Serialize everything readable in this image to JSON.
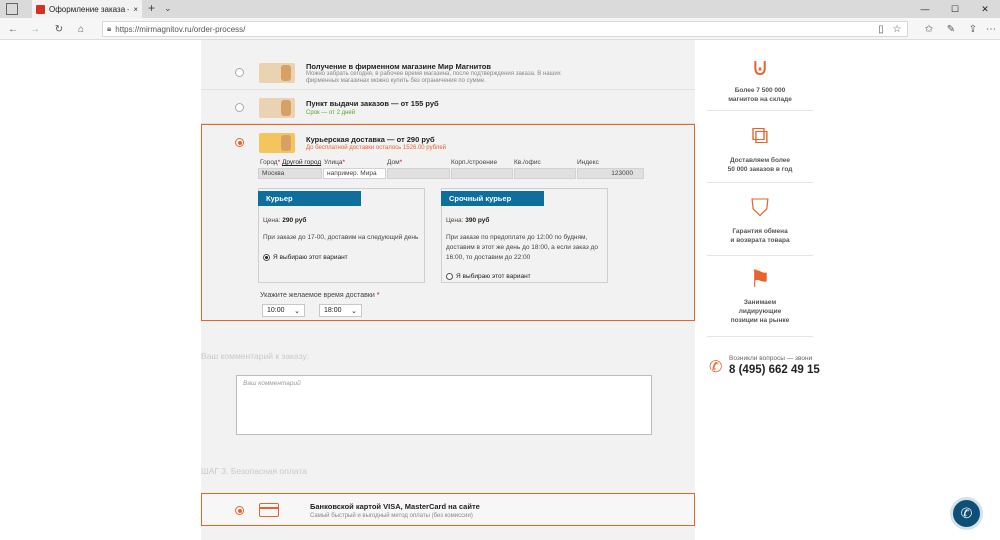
{
  "browser": {
    "tab_title": "Оформление заказа —",
    "tab_close": "×",
    "url": "https://mirmagnitov.ru/order-process/",
    "window_controls": [
      "—",
      "☐",
      "✕"
    ],
    "nav_icons": [
      "back-icon",
      "forward-icon",
      "refresh-icon",
      "home-icon"
    ]
  },
  "delivery_options": [
    {
      "title": "Получение в фирменном магазине Мир Магнитов",
      "subtitle_line1": "Можно забрать сегодня, в рабочее время магазина, после подтверждения заказа. В наших",
      "subtitle_line2": "фирменных магазинах можно купить без ограничения по сумме."
    },
    {
      "title": "Пункт выдачи заказов — от 155 руб",
      "subtitle": "Срок — от 2 дней"
    },
    {
      "title": "Курьерская доставка — от 290 руб",
      "subtitle": "До бесплатной доставки осталось 1526.00 рублей"
    }
  ],
  "address": {
    "city_label": "Город",
    "other_city": "Другой город",
    "street_label": "Улица",
    "house_label": "Дом",
    "building_label": "Корп./строение",
    "apt_label": "Кв./офис",
    "zip_label": "Индекс",
    "city_value": "Москва",
    "street_placeholder": "например. Мира",
    "zip_value": "123000"
  },
  "couriers": [
    {
      "banner": "Курьер",
      "price_label": "Цена:",
      "price": "290 руб",
      "desc": "При заказе до 17-00, доставим на следующий день",
      "choose": "Я выбираю этот вариант",
      "selected": true
    },
    {
      "banner": "Срочный курьер",
      "price_label": "Цена:",
      "price": "390 руб",
      "desc_line1": "При заказе по предоплате до 12:00 по будням,",
      "desc_line2": "доставим в этот же день до 18:00, а если заказ до",
      "desc_line3": "16:00, то доставим до 22:00",
      "choose": "Я выбираю этот вариант",
      "selected": false
    }
  ],
  "time": {
    "label": "Укажите желаемое время доставки",
    "from": "10:00",
    "to": "18:00",
    "caret": "⌄"
  },
  "comment": {
    "heading": "Ваш комментарий к заказу:",
    "placeholder": "Ваш комментарий"
  },
  "payment": {
    "heading": "ШАГ 3. Безопасная оплата",
    "title": "Банковской картой VISA, MasterCard на сайте",
    "subtitle": "Самый быстрый и выгодный метод оплаты (без комиссии)"
  },
  "sidebar": {
    "items": [
      {
        "icon": "magnet-icon",
        "line1": "Более 7 500 000",
        "line2": "магнитов на складе"
      },
      {
        "icon": "delivery-box-icon",
        "line1": "Доставляем более",
        "line2": "50 000 заказов в год"
      },
      {
        "icon": "guarantee-shield-icon",
        "line1": "Гарантия обмена",
        "line2": "и возврата товара"
      },
      {
        "icon": "leader-flag-icon",
        "line1": "Занимаем",
        "line2": "лидирующие",
        "line3": "позиции на рынке"
      }
    ],
    "phone_question": "Возникли вопросы — звони",
    "phone_number": "8 (495) 662 49 15"
  },
  "colors": {
    "accent": "#e8622c",
    "banner_blue": "#0e6e9e",
    "call_button": "#0e4f78",
    "green": "#54a92b"
  }
}
